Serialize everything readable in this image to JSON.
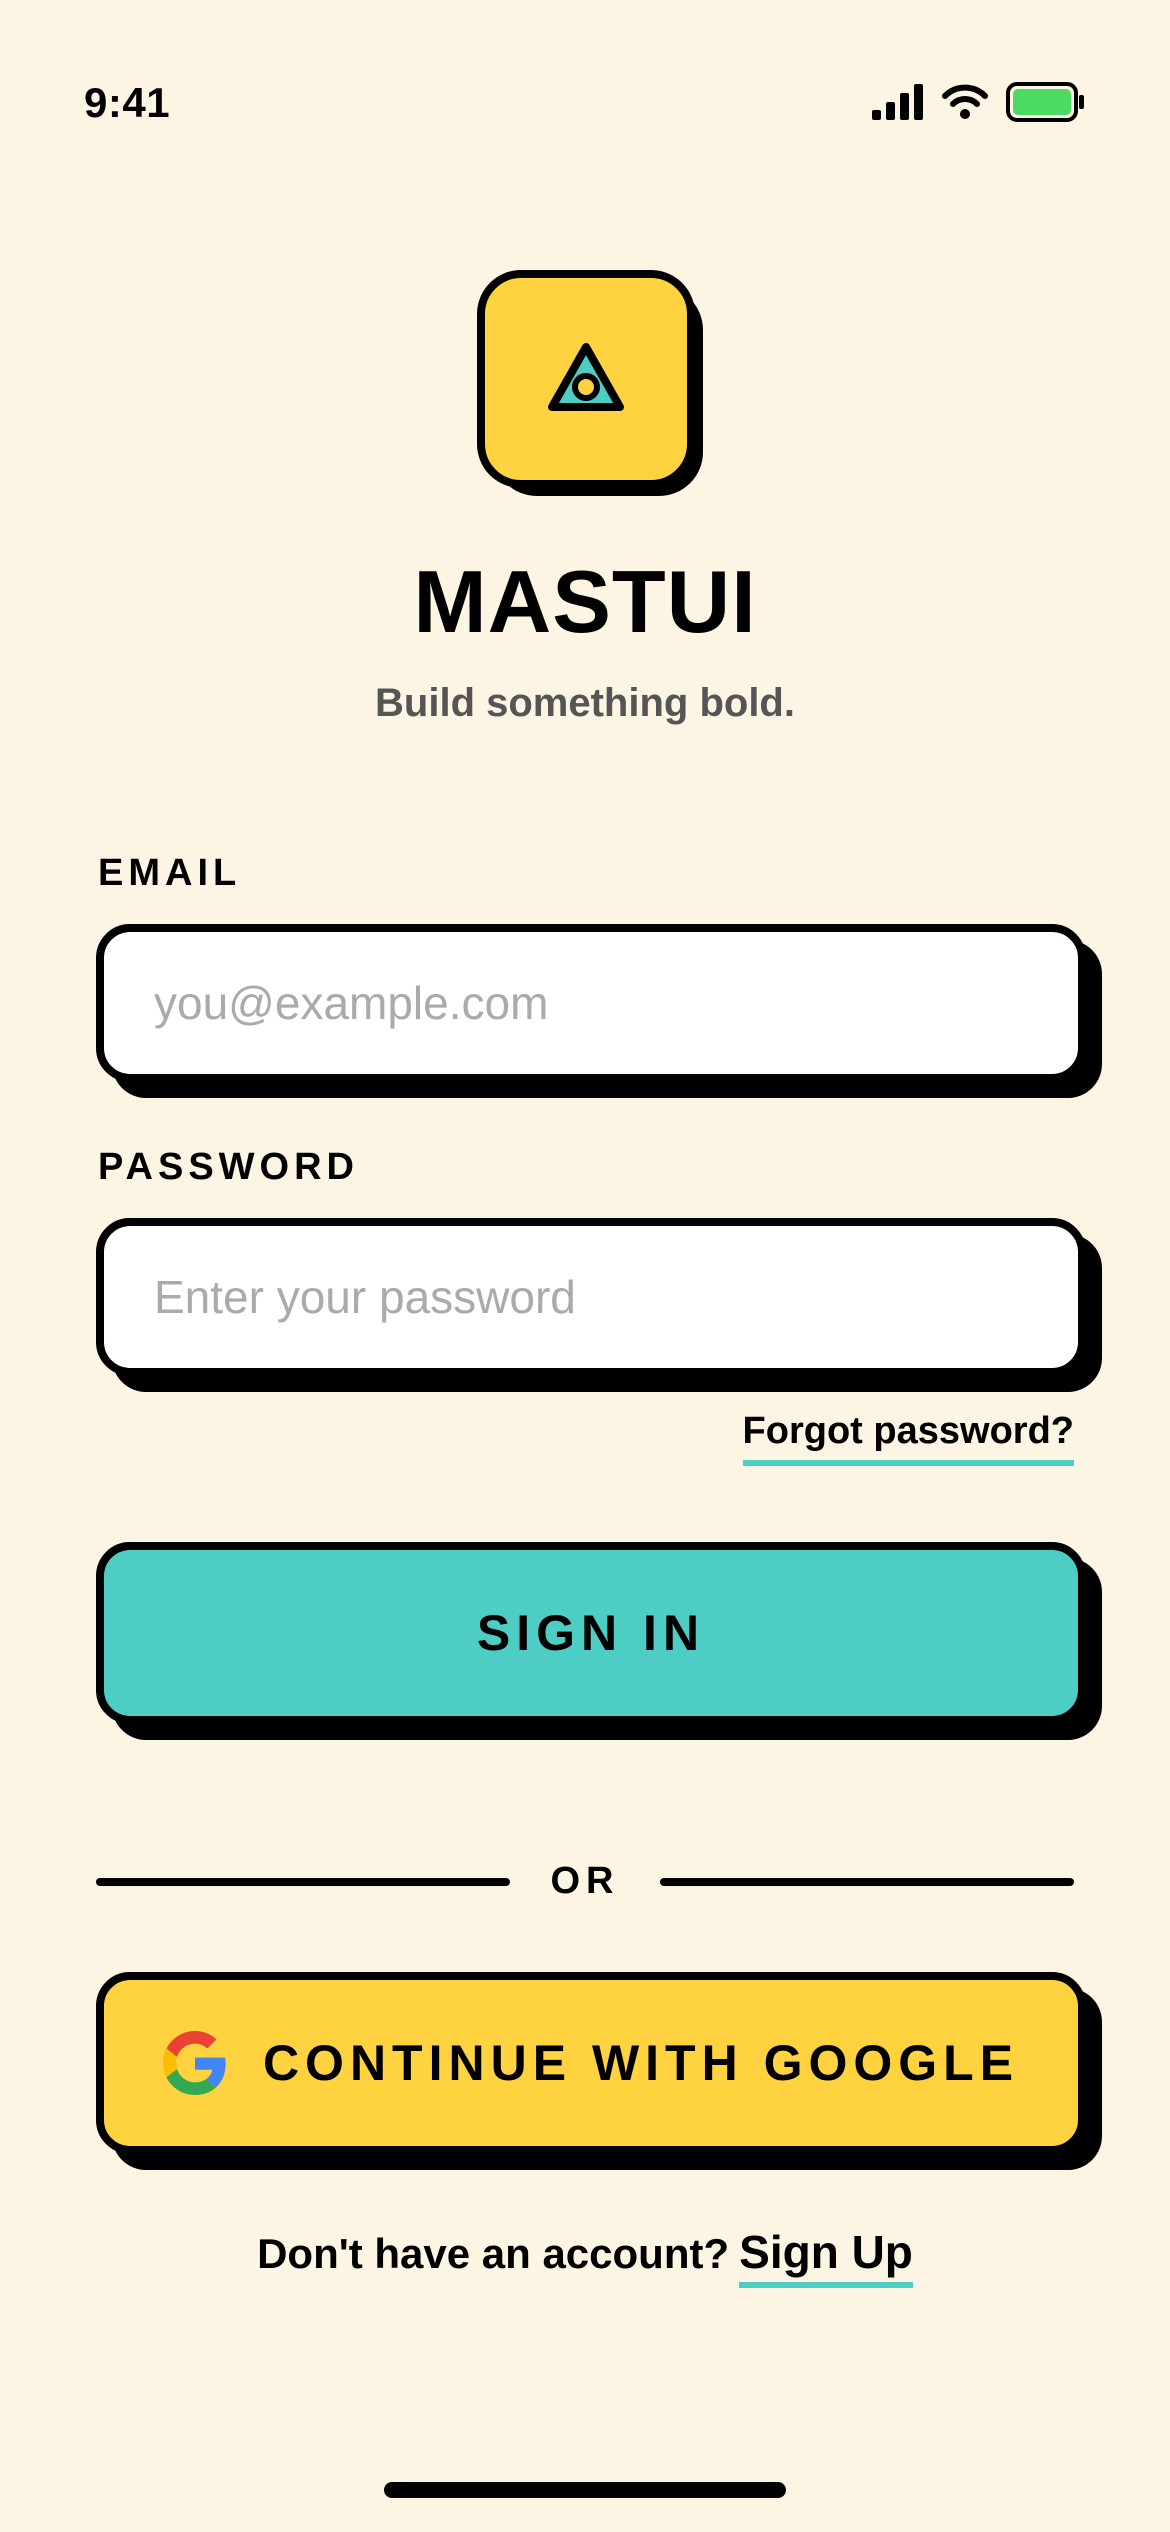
{
  "status_bar": {
    "time": "9:41",
    "icons": [
      "signal-icon",
      "wifi-icon",
      "battery-icon"
    ],
    "battery_color": "#4CD964"
  },
  "brand": {
    "logo_icon": "triangle-eye-icon",
    "title": "MASTUI",
    "tagline": "Build something bold."
  },
  "form": {
    "email_label": "EMAIL",
    "email_placeholder": "you@example.com",
    "email_value": "",
    "password_label": "PASSWORD",
    "password_placeholder": "Enter your password",
    "password_value": "",
    "forgot_link": "Forgot password?",
    "sign_in_label": "SIGN IN"
  },
  "divider": {
    "label": "OR"
  },
  "social": {
    "google_label": "CONTINUE WITH GOOGLE",
    "google_icon": "google-icon"
  },
  "footer": {
    "prompt": "Don't have an account?",
    "signup_link": "Sign Up"
  },
  "colors": {
    "background": "#FDF5E3",
    "accent_yellow": "#FFD23F",
    "accent_teal": "#4ECDC4",
    "ink": "#000000",
    "placeholder": "#AAAAAA"
  }
}
